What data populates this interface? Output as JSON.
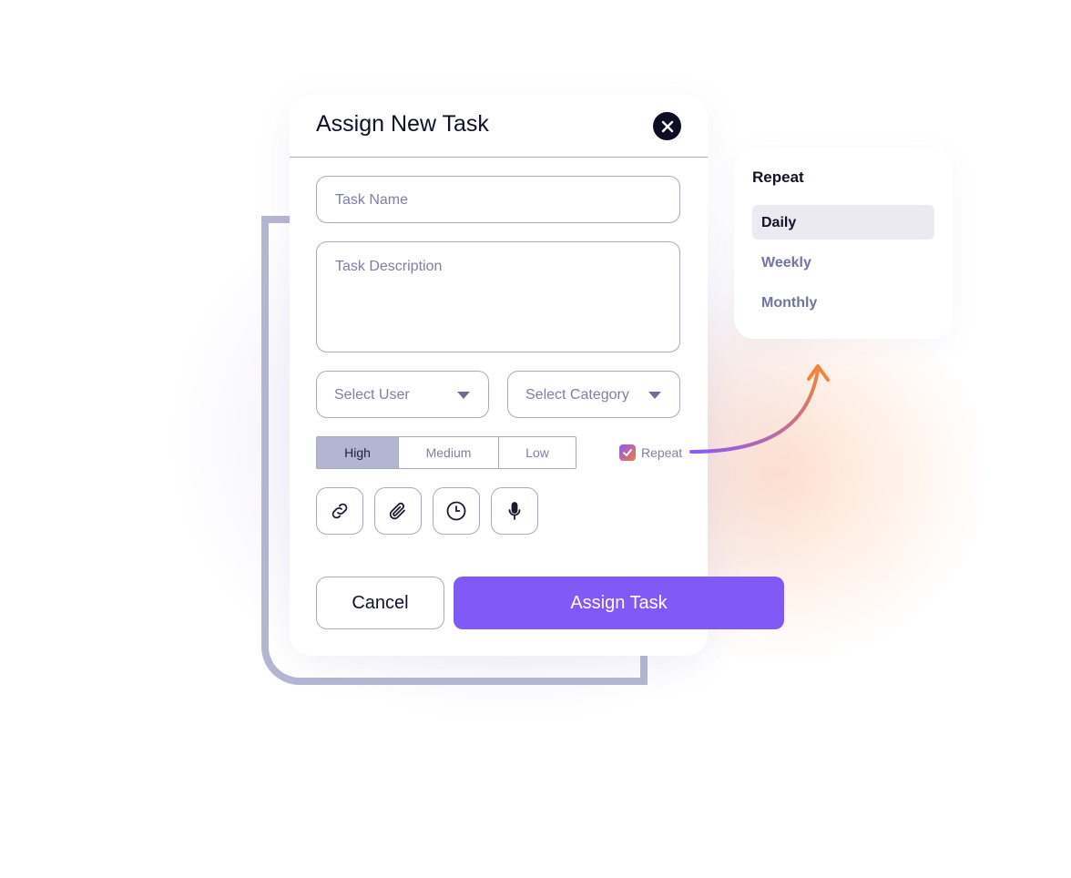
{
  "modal": {
    "title": "Assign New Task",
    "task_name_placeholder": "Task Name",
    "task_description_placeholder": "Task Description",
    "select_user_placeholder": "Select User",
    "select_category_placeholder": "Select Category",
    "priority": {
      "options": [
        "High",
        "Medium",
        "Low"
      ],
      "selected": "High"
    },
    "repeat_label": "Repeat",
    "repeat_checked": true,
    "tools": [
      "link-icon",
      "paperclip-icon",
      "clock-icon",
      "microphone-icon"
    ],
    "cancel_label": "Cancel",
    "assign_label": "Assign Task"
  },
  "repeat_menu": {
    "title": "Repeat",
    "options": [
      "Daily",
      "Weekly",
      "Monthly"
    ],
    "selected": "Daily"
  },
  "colors": {
    "accent": "#8059f6",
    "frame": "#b4b6d2",
    "arrow_start": "#8a5bf2",
    "arrow_end": "#f2843e"
  }
}
